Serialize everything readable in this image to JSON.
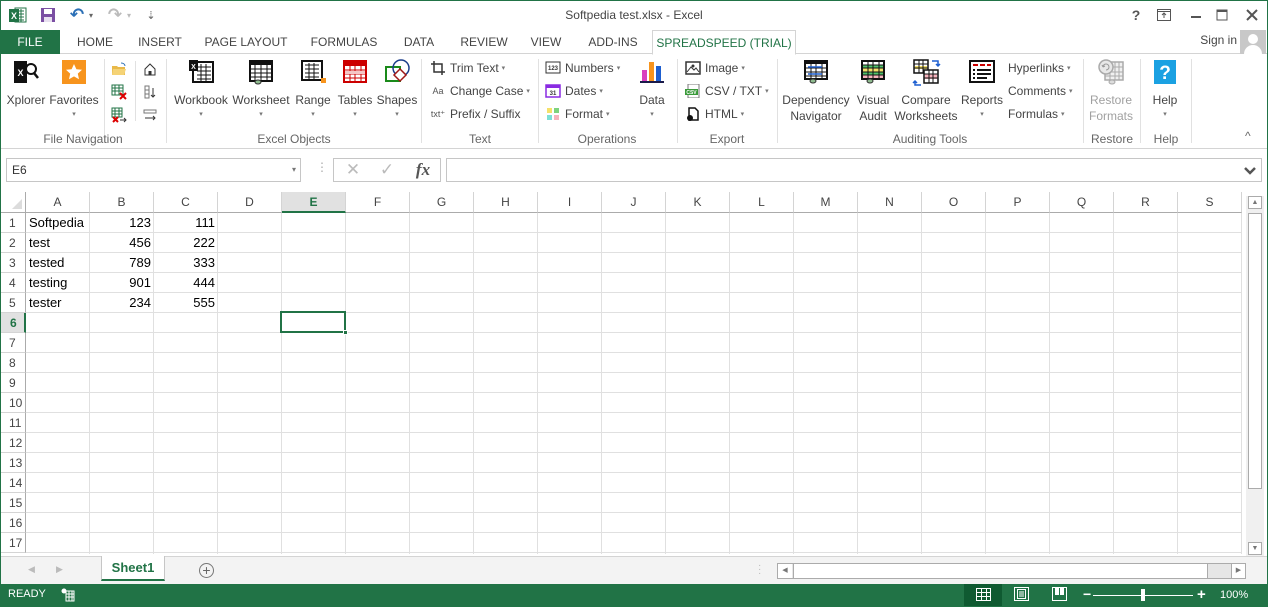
{
  "window": {
    "title": "Softpedia test.xlsx - Excel",
    "controls": {
      "help": "?",
      "ribbon_display": "⬒",
      "minimize": "—",
      "maximize": "☐",
      "close": "✕"
    }
  },
  "qat": {
    "undo": "↶",
    "redo": "↷",
    "customize": "⇣",
    "dropdown": "▾"
  },
  "tabs": [
    {
      "label": "FILE"
    },
    {
      "label": "HOME"
    },
    {
      "label": "INSERT"
    },
    {
      "label": "PAGE LAYOUT"
    },
    {
      "label": "FORMULAS"
    },
    {
      "label": "DATA"
    },
    {
      "label": "REVIEW"
    },
    {
      "label": "VIEW"
    },
    {
      "label": "ADD-INS"
    },
    {
      "label": "SPREADSPEED (TRIAL)",
      "active": true
    }
  ],
  "account": {
    "signin_label": "Sign in"
  },
  "ribbon": {
    "groups": {
      "file_navigation": {
        "label": "File Navigation",
        "xplorer": "Xplorer",
        "favorites": "Favorites"
      },
      "excel_objects": {
        "label": "Excel Objects",
        "workbook": "Workbook",
        "worksheet": "Worksheet",
        "range": "Range",
        "tables": "Tables",
        "shapes": "Shapes"
      },
      "text": {
        "label": "Text",
        "trim_text": "Trim Text",
        "change_case": "Change Case",
        "prefix_suffix": "Prefix / Suffix",
        "change_case_icon_text": "Aa",
        "prefix_icon_text": "txt⁺"
      },
      "operations": {
        "label": "Operations",
        "numbers": "Numbers",
        "dates": "Dates",
        "format": "Format",
        "data": "Data",
        "numbers_icon_text": "123",
        "dates_icon_text": "31"
      },
      "export": {
        "label": "Export",
        "image": "Image",
        "csv_txt": "CSV / TXT",
        "html": "HTML",
        "csv_icon_text": "CSV"
      },
      "auditing_tools": {
        "label": "Auditing Tools",
        "dependency_navigator": [
          "Dependency",
          "Navigator"
        ],
        "visual_audit": [
          "Visual",
          "Audit"
        ],
        "compare_worksheets": [
          "Compare",
          "Worksheets"
        ],
        "reports": "Reports",
        "hyperlinks": "Hyperlinks",
        "comments": "Comments",
        "formulas": "Formulas"
      },
      "restore": {
        "label": "Restore",
        "restore_formats": [
          "Restore",
          "Formats"
        ]
      },
      "help": {
        "label": "Help",
        "help": "Help",
        "help_icon_text": "?"
      }
    },
    "collapse": "^",
    "caret": "▾"
  },
  "formula_bar": {
    "name_box": "E6",
    "cancel": "✕",
    "enter": "✓",
    "fx": "fx",
    "formula": "",
    "dots": "⋮",
    "expand": "⌄"
  },
  "sheet": {
    "columns": [
      "A",
      "B",
      "C",
      "D",
      "E",
      "F",
      "G",
      "H",
      "I",
      "J",
      "K",
      "L",
      "M",
      "N",
      "O",
      "P",
      "Q",
      "R",
      "S"
    ],
    "selected_column": "E",
    "rows": [
      "1",
      "2",
      "3",
      "4",
      "5",
      "6",
      "7",
      "8",
      "9",
      "10",
      "11",
      "12",
      "13",
      "14",
      "15",
      "16",
      "17"
    ],
    "selected_row": "6",
    "active_cell": "E6",
    "cells": [
      [
        "Softpedia",
        "123",
        "111"
      ],
      [
        "test",
        "456",
        "222"
      ],
      [
        "tested",
        "789",
        "333"
      ],
      [
        "testing",
        "901",
        "444"
      ],
      [
        "tester",
        "234",
        "555"
      ]
    ]
  },
  "sheet_tabs": {
    "prev": "◀",
    "next": "▶",
    "tabs": [
      {
        "label": "Sheet1",
        "active": true
      }
    ],
    "add": "+"
  },
  "scroll": {
    "up": "▲",
    "down": "▼",
    "left": "◀",
    "right": "▶"
  },
  "status": {
    "text": "READY",
    "zoom_minus": "−",
    "zoom_plus": "+",
    "zoom_level": "100%",
    "zoom_percent": 100
  }
}
